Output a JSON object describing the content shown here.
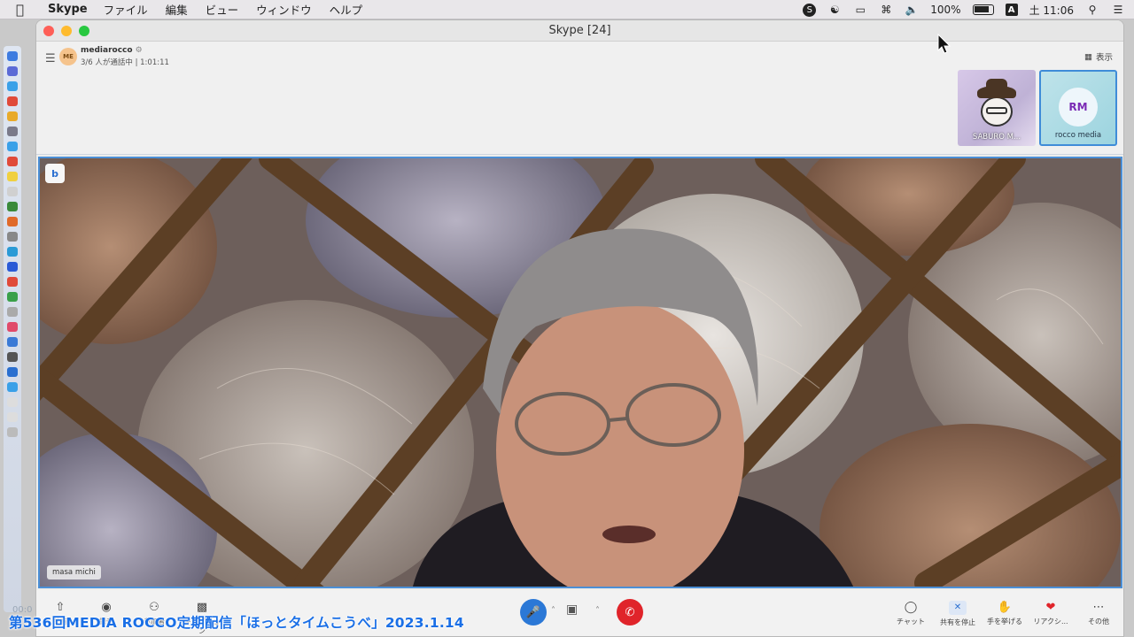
{
  "menubar": {
    "app_name": "Skype",
    "menus": [
      "ファイル",
      "編集",
      "ビュー",
      "ウィンドウ",
      "ヘルプ"
    ],
    "battery": "100%",
    "input_source": "A",
    "clock": "土 11:06"
  },
  "window": {
    "title": "Skype [24]"
  },
  "call": {
    "host_initials": "ME",
    "host_name": "mediarocco",
    "status": "3/6 人が通話中 | 1:01:11",
    "view_label": "表示"
  },
  "thumbnails": [
    {
      "name": "SABURO M...",
      "type": "cartoon"
    },
    {
      "name": "rocco media",
      "initials": "RM",
      "selected": true
    }
  ],
  "main_video": {
    "participant_label": "masa michi",
    "badge": "b"
  },
  "controls": {
    "left": [
      {
        "label": "共有",
        "icon": "share-icon"
      },
      {
        "label": "録音",
        "icon": "record-icon"
      },
      {
        "label": "参加者",
        "icon": "participants-icon"
      },
      {
        "label": "キャプション",
        "icon": "captions-icon"
      }
    ],
    "right": [
      {
        "label": "チャット",
        "icon": "chat-icon"
      },
      {
        "label": "共有を停止",
        "icon": "stop-share-icon"
      },
      {
        "label": "手を挙げる",
        "icon": "raise-hand-icon"
      },
      {
        "label": "リアクシ...",
        "icon": "reaction-icon"
      },
      {
        "label": "その他",
        "icon": "more-icon"
      }
    ]
  },
  "overlay": {
    "caption": "第536回MEDIA ROCCO定期配信「ほっとタイムこうべ」2023.1.14",
    "timecode": "00:0"
  },
  "colors": {
    "accent": "#2b78d6",
    "end_call": "#e0242a",
    "caption": "#1a6fe6"
  }
}
